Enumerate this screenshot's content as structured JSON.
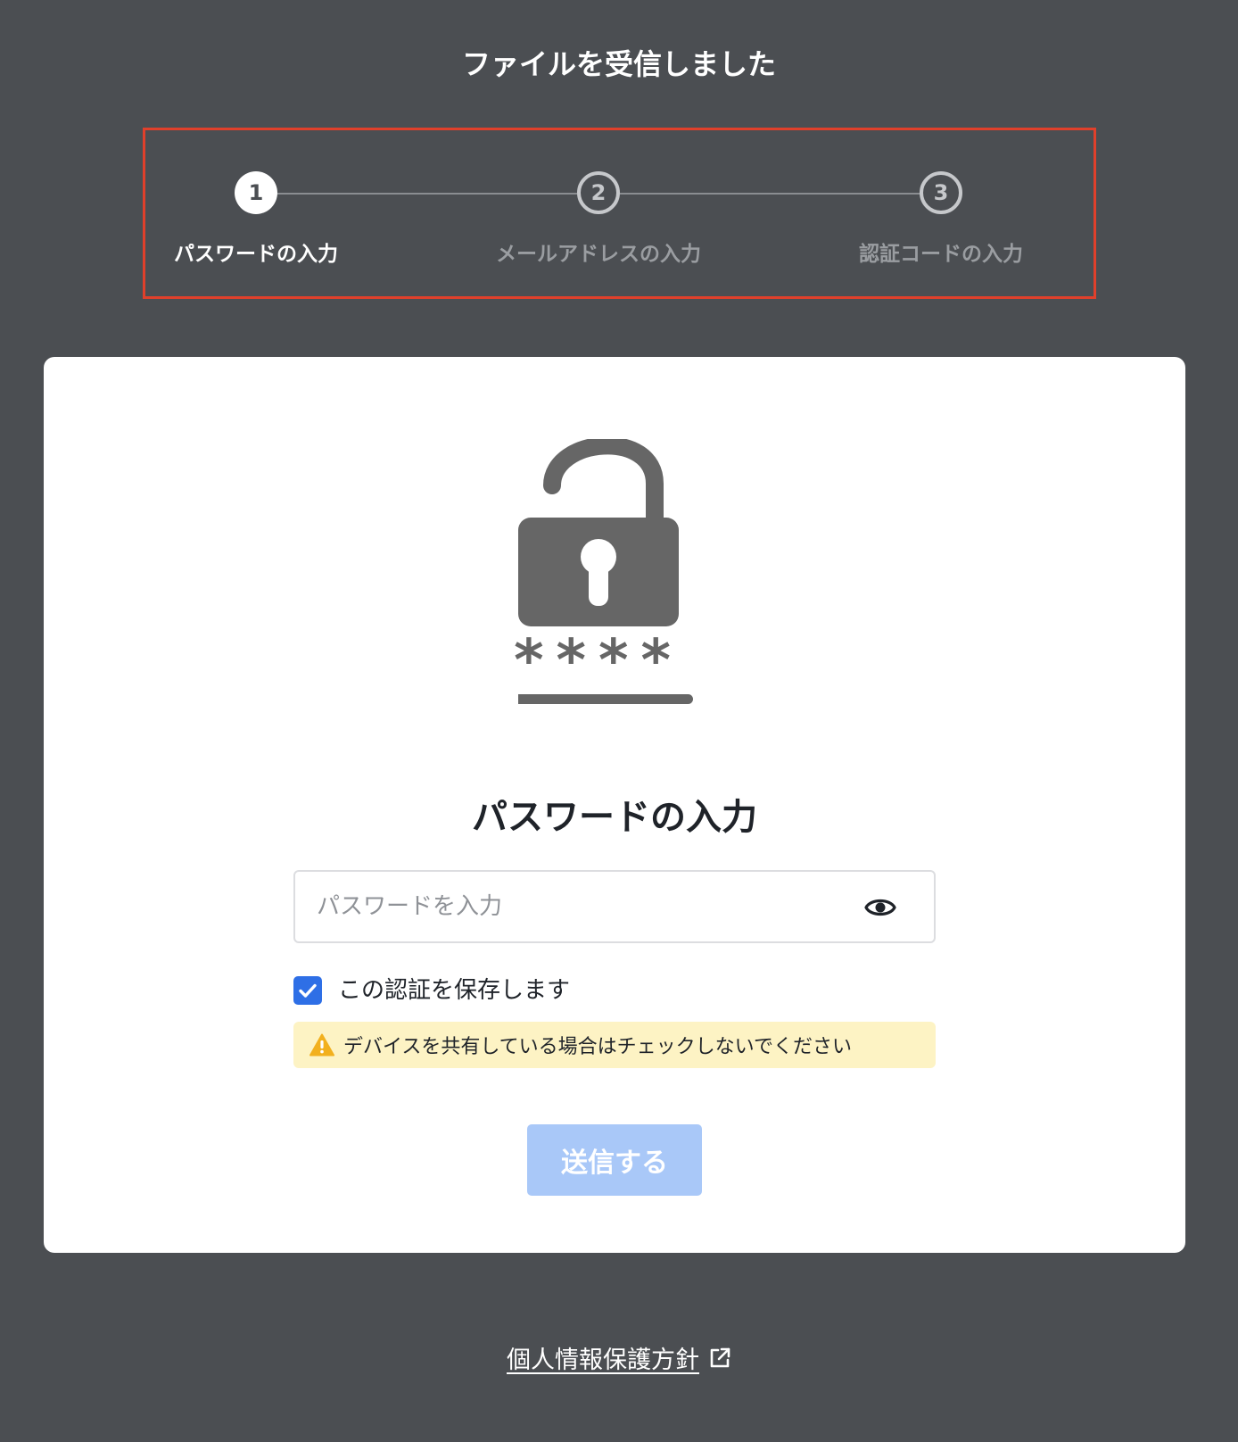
{
  "page": {
    "title": "ファイルを受信しました"
  },
  "stepper": {
    "steps": [
      {
        "number": "1",
        "label": "パスワードの入力",
        "state": "active"
      },
      {
        "number": "2",
        "label": "メールアドレスの入力",
        "state": "inactive"
      },
      {
        "number": "3",
        "label": "認証コードの入力",
        "state": "inactive"
      }
    ]
  },
  "card": {
    "heading": "パスワードの入力",
    "lock_mask": "****",
    "password_input": {
      "value": "",
      "placeholder": "パスワードを入力"
    },
    "remember": {
      "label": "この認証を保存します",
      "checked": true
    },
    "warning": {
      "text": "デバイスを共有している場合はチェックしないでください"
    },
    "submit_label": "送信する"
  },
  "footer": {
    "privacy_link": "個人情報保護方針"
  },
  "colors": {
    "background": "#4b4e52",
    "highlight_border": "#e0402b",
    "primary": "#2e6fe6",
    "button_disabled": "#a9c8f8",
    "warning_bg": "#fdf3c4",
    "warning_icon": "#f2b01e",
    "icon_gray": "#666666"
  },
  "icons": {
    "lock": "unlocked-padlock-icon",
    "eye": "eye-icon",
    "check": "check-icon",
    "warning": "warning-triangle-icon",
    "external": "external-link-icon"
  }
}
